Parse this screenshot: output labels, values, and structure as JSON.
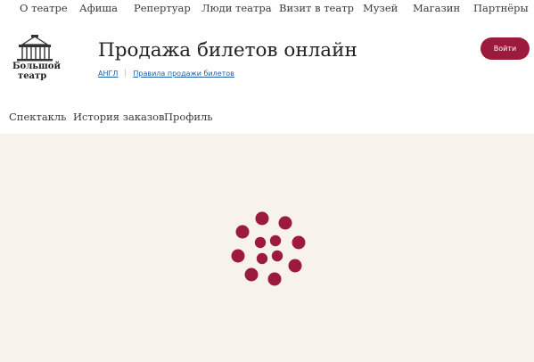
{
  "top_nav": [
    {
      "label": "О театре"
    },
    {
      "label": "Афиша"
    },
    {
      "label": "Репертуар"
    },
    {
      "label": "Люди театра"
    },
    {
      "label": "Визит в театр"
    },
    {
      "label": "Музей"
    },
    {
      "label": "Магазин"
    },
    {
      "label": "Партнёры"
    }
  ],
  "logo": {
    "line1": "Большой",
    "line2": "театр",
    "icon": "theatre-building-icon"
  },
  "page_title": "Продажа билетов онлайн",
  "sublinks": {
    "lang": "АНГЛ",
    "rules": "Правила продажи билетов"
  },
  "login_button": "Войти",
  "tabs": [
    {
      "label": "Спектакль"
    },
    {
      "label": "История заказов"
    },
    {
      "label": "Профиль"
    }
  ],
  "colors": {
    "accent": "#9c1a3c",
    "content_bg": "#f8f3ea",
    "link": "#1f5fa0"
  },
  "loading_icon": "spinner-icon"
}
